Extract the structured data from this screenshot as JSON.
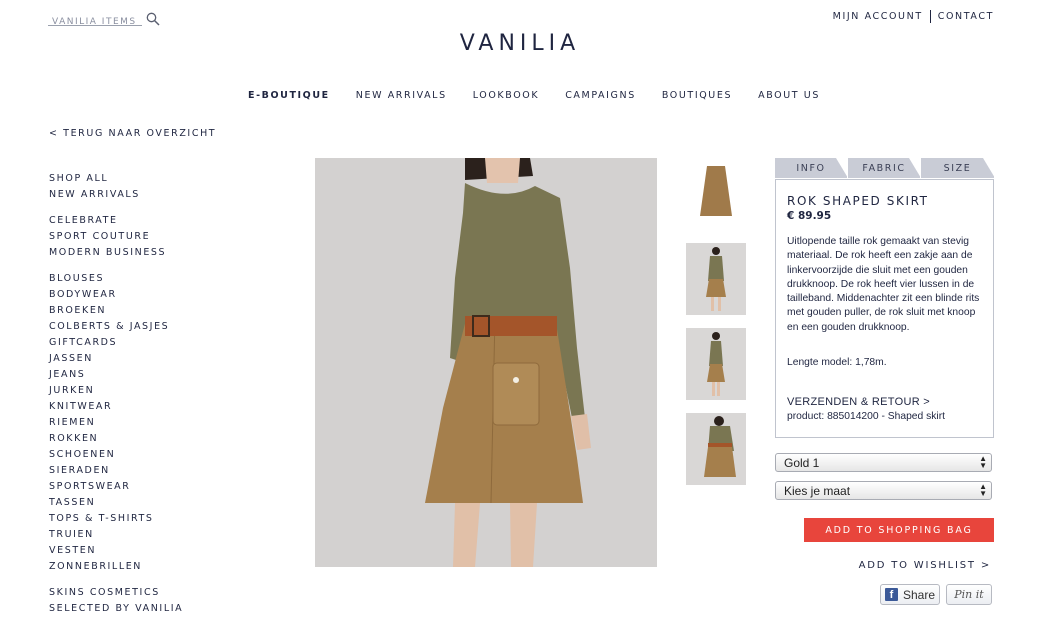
{
  "header": {
    "search_placeholder": "VANILIA ITEMS",
    "logo": "VANILIA",
    "account_link": "MIJN ACCOUNT",
    "contact_link": "CONTACT"
  },
  "nav": [
    "E-BOUTIQUE",
    "NEW ARRIVALS",
    "LOOKBOOK",
    "CAMPAIGNS",
    "BOUTIQUES",
    "ABOUT US"
  ],
  "back_link": "< TERUG NAAR OVERZICHT",
  "sidebar": {
    "group1": [
      "SHOP ALL",
      "NEW ARRIVALS"
    ],
    "group2": [
      "CELEBRATE",
      "SPORT COUTURE",
      "MODERN BUSINESS"
    ],
    "group3": [
      "BLOUSES",
      "BODYWEAR",
      "BROEKEN",
      "COLBERTS & JASJES",
      "GIFTCARDS",
      "JASSEN",
      "JEANS",
      "JURKEN",
      "KNITWEAR",
      "RIEMEN",
      "ROKKEN",
      "SCHOENEN",
      "SIERADEN",
      "SPORTSWEAR",
      "TASSEN",
      "TOPS & T-SHIRTS",
      "TRUIEN",
      "VESTEN",
      "ZONNEBRILLEN"
    ],
    "group4": [
      "SKINS COSMETICS",
      "SELECTED BY VANILIA"
    ]
  },
  "product": {
    "tabs": [
      "INFO",
      "FABRIC",
      "SIZE"
    ],
    "title": "ROK SHAPED SKIRT",
    "price": "€ 89.95",
    "description": "Uitlopende taille rok gemaakt van stevig materiaal. De rok heeft een zakje aan de linkervoorzijde die sluit met een gouden drukknoop. De rok heeft vier lussen in de tailleband. Middenachter zit een blinde rits met gouden puller, de rok sluit met knoop en een gouden drukknoop.",
    "model_length": "Lengte model: 1,78m.",
    "shipping_link": "VERZENDEN & RETOUR >",
    "product_code": "product: 885014200 - Shaped skirt",
    "color_select": "Gold 1",
    "size_select": "Kies je maat",
    "add_to_bag": "ADD TO SHOPPING BAG",
    "wishlist": "ADD TO WISHLIST >",
    "share_label": "Share",
    "pin_label": "Pin it"
  },
  "colors": {
    "accent_red": "#e8453c",
    "text_navy": "#1f2540",
    "tab_grey": "#c9ccd6"
  }
}
